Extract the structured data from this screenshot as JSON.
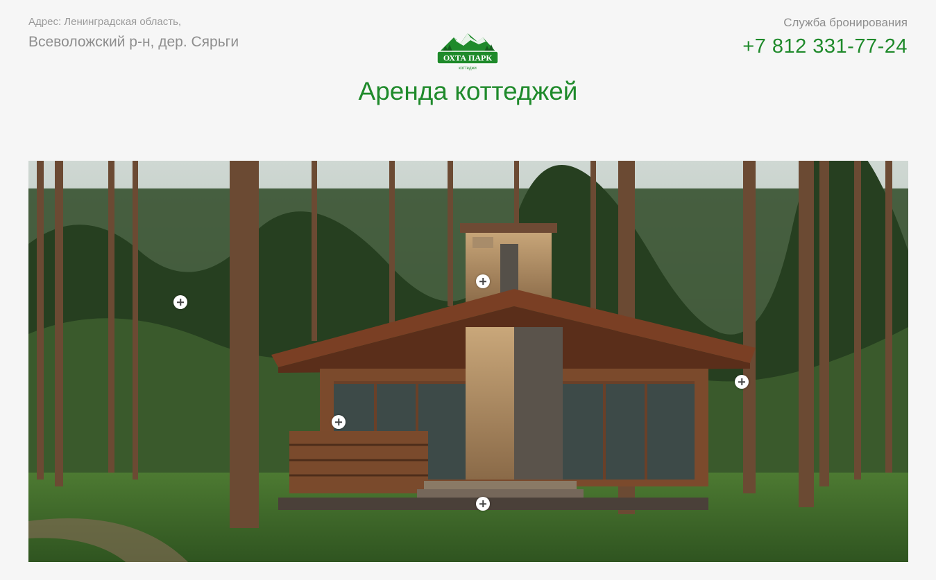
{
  "header": {
    "address_label": "Адрес: Ленинградская область,",
    "address_value": "Всеволожский р-н, дер. Сярьги",
    "booking_label": "Служба бронирования",
    "phone": "+7 812 331-77-24"
  },
  "logo": {
    "name": "ОХТА ПАРК",
    "sub": "коттеджи",
    "icon": "mountains-logo-icon"
  },
  "page_title": "Аренда коттеджей",
  "hero": {
    "image": "wooden-cottage-in-pine-forest",
    "hotspots": [
      {
        "id": "hotspot-trees-left",
        "label": "+"
      },
      {
        "id": "hotspot-chimney",
        "label": "+"
      },
      {
        "id": "hotspot-trees-right",
        "label": "+"
      },
      {
        "id": "hotspot-terrace",
        "label": "+"
      },
      {
        "id": "hotspot-steps",
        "label": "+"
      }
    ]
  },
  "colors": {
    "accent": "#1f8a2b",
    "muted_text": "#8e8e8e",
    "background": "#f6f6f6"
  }
}
